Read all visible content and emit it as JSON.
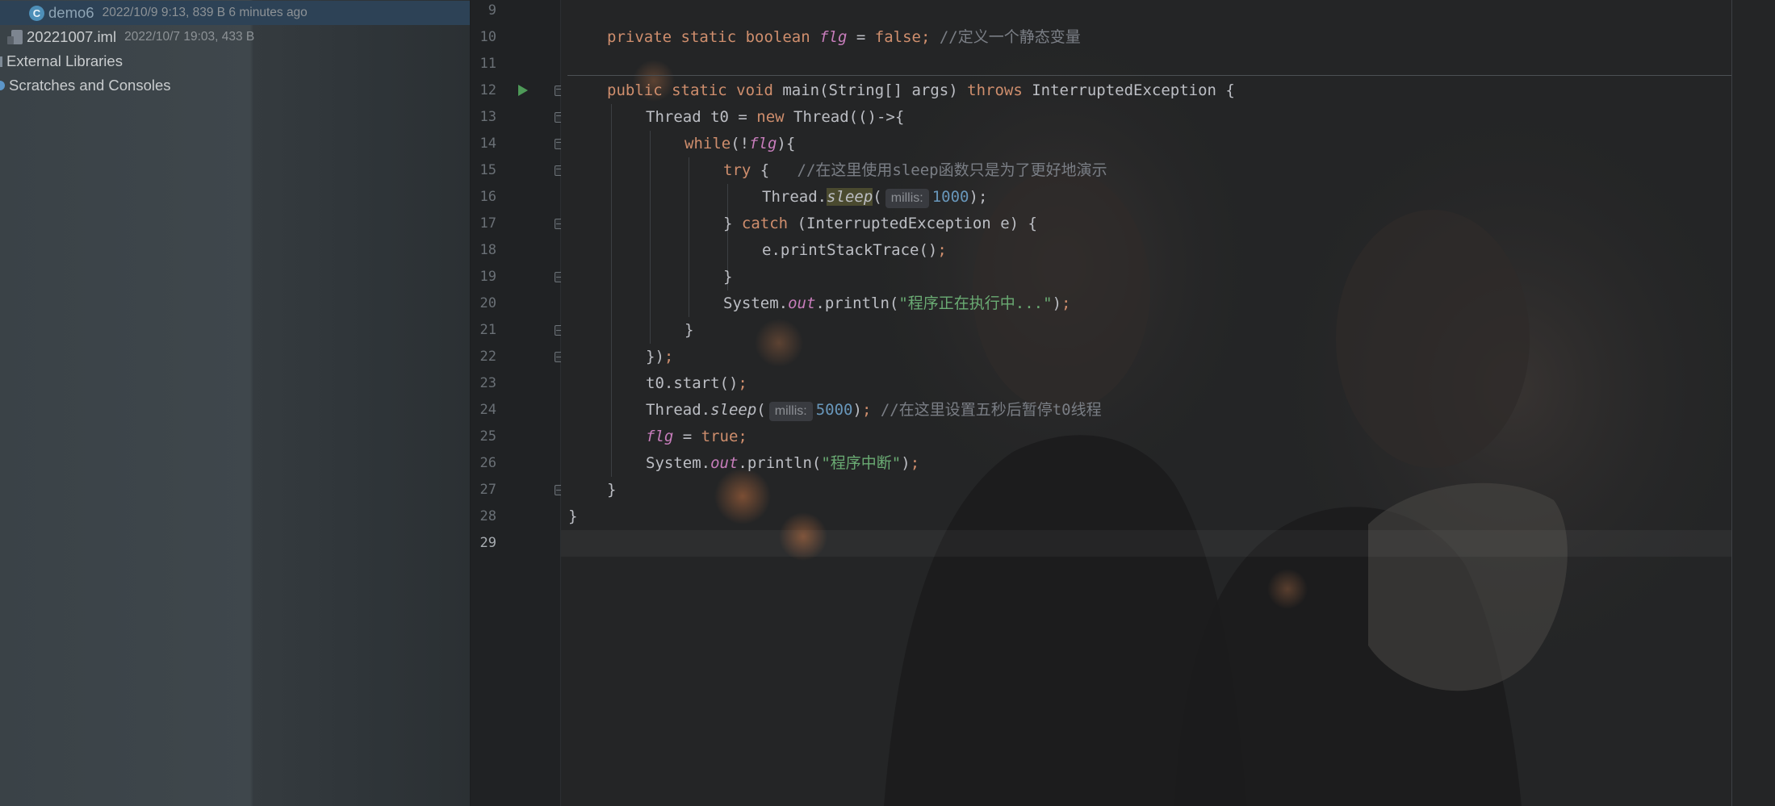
{
  "project_tree": {
    "items": [
      {
        "name": "demo6",
        "meta": "2022/10/9 9:13, 839 B 6 minutes ago",
        "icon": "java-class-icon"
      },
      {
        "name": "20221007.iml",
        "meta": "2022/10/7 19:03, 433 B",
        "icon": "iml-file-icon"
      },
      {
        "name": "External Libraries",
        "meta": "",
        "icon": "library-icon"
      },
      {
        "name": "Scratches and Consoles",
        "meta": "",
        "icon": "scratch-icon"
      }
    ]
  },
  "editor": {
    "line_numbers": [
      "9",
      "10",
      "11",
      "12",
      "13",
      "14",
      "15",
      "16",
      "17",
      "18",
      "19",
      "20",
      "21",
      "22",
      "23",
      "24",
      "25",
      "26",
      "27",
      "28",
      "29"
    ],
    "current_line": "29",
    "code": {
      "l10": {
        "kw": "private static boolean ",
        "field": "flg",
        "op": " = ",
        "val": "false",
        "semi": ";",
        "comment": " //定义一个静态变量"
      },
      "l12": {
        "kw1": "public static void ",
        "name": "main(String[] args) ",
        "kw2": "throws ",
        "rest": "InterruptedException {"
      },
      "l13": {
        "a": "Thread t0 = ",
        "kw": "new ",
        "b": "Thread(()->{"
      },
      "l14": {
        "kw": "while",
        "a": "(!",
        "field": "flg",
        "b": "){"
      },
      "l15": {
        "kw": "try",
        "a": " {   ",
        "comment": "//在这里使用sleep函数只是为了更好地演示"
      },
      "l16": {
        "a": "Thread.",
        "method": "sleep",
        "b": "(",
        "hint": "millis:",
        "num": "1000",
        "c": ");"
      },
      "l17": {
        "a": "} ",
        "kw": "catch",
        "b": " (InterruptedException e) {"
      },
      "l18": {
        "a": "e.printStackTrace()",
        "semi": ";"
      },
      "l19": {
        "a": "}"
      },
      "l20": {
        "a": "System.",
        "field": "out",
        "b": ".println(",
        "str": "\"程序正在执行中...\"",
        "c": ")",
        "semi": ";"
      },
      "l21": {
        "a": "}"
      },
      "l22": {
        "a": "})",
        "semi": ";"
      },
      "l23": {
        "a": "t0.start()",
        "semi": ";"
      },
      "l24": {
        "a": "Thread.",
        "method": "sleep",
        "b": "(",
        "hint": "millis:",
        "num": "5000",
        "c": ")",
        "semi": ";",
        "comment": " //在这里设置五秒后暂停t0线程"
      },
      "l25": {
        "field": "flg",
        "a": " = ",
        "val": "true",
        "semi": ";"
      },
      "l26": {
        "a": "System.",
        "field": "out",
        "b": ".println(",
        "str": "\"程序中断\"",
        "c": ")",
        "semi": ";"
      },
      "l27": {
        "a": "}"
      },
      "l28": {
        "a": "}"
      }
    }
  },
  "colors": {
    "keyword": "#cf8e6d",
    "comment": "#7a7e85",
    "string": "#6aab73",
    "number": "#2aacb8",
    "field": "#c77dbb",
    "selection": "#2d4256"
  }
}
